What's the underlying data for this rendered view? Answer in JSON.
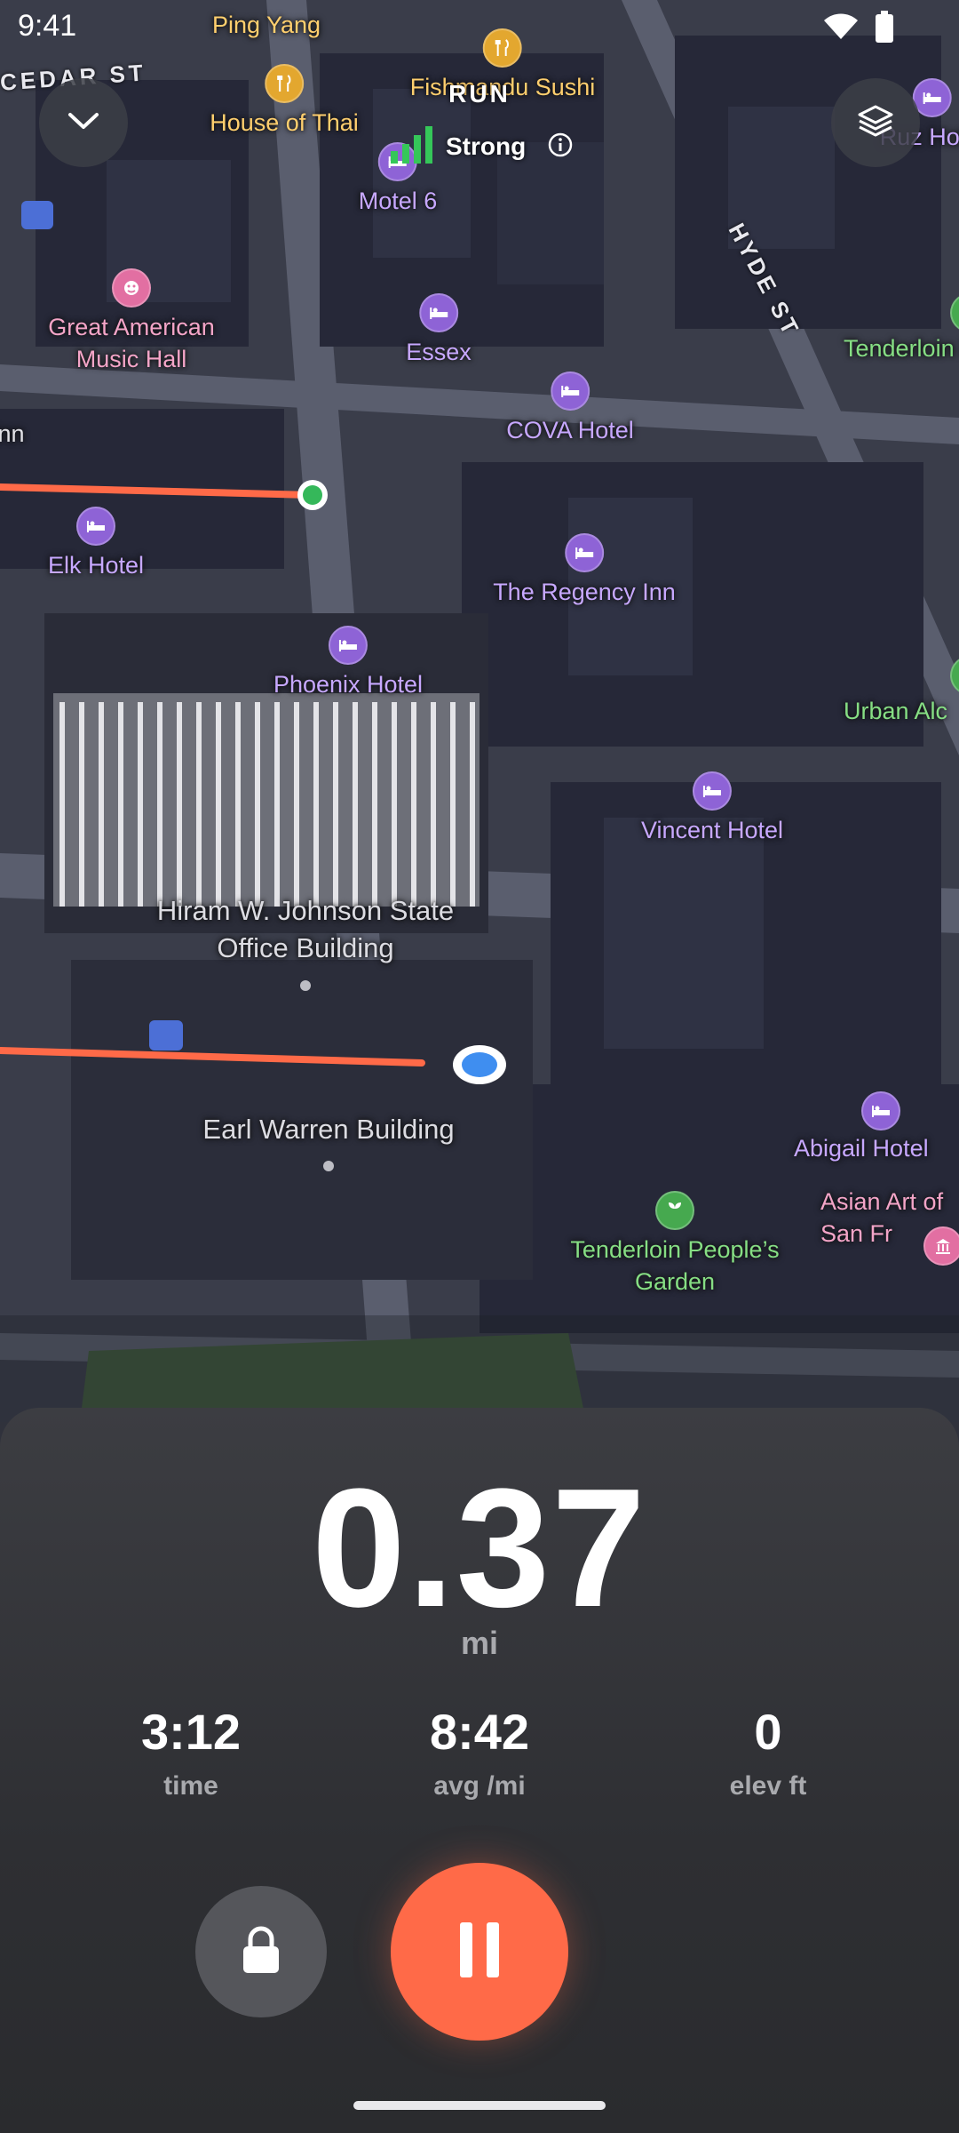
{
  "status_bar": {
    "time": "9:41"
  },
  "header": {
    "activity": "RUN",
    "gps_label": "Strong"
  },
  "map": {
    "streets": [
      "CEDAR ST",
      "HYDE ST"
    ],
    "pois": {
      "ping_yang": "Ping Yang",
      "fishmandu": "Fishmandu Sushi",
      "house_of_thai": "House of Thai",
      "motel6": "Motel 6",
      "hotel_ruz": "Ruz Hotel",
      "great_american": "Great American Music Hall",
      "essex": "Essex",
      "cova": "COVA Hotel",
      "tenderloin_play": "Tenderloin Playg",
      "inn_edge": "Inn",
      "elk": "Elk Hotel",
      "regency": "The Regency Inn",
      "phoenix": "Phoenix Hotel",
      "urban_alc": "Urban Alc",
      "vincent": "Vincent Hotel",
      "hiram": "Hiram W. Johnson State Office Building",
      "earl_warren": "Earl Warren Building",
      "abigail": "Abigail Hotel",
      "tenderloin_garden": "Tenderloin People’s Garden",
      "asian_art": "Asian Art of San Fr"
    }
  },
  "stats": {
    "distance_value": "0.37",
    "distance_unit": "mi",
    "time_value": "3:12",
    "time_label": "time",
    "pace_value": "8:42",
    "pace_label": "avg /mi",
    "elev_value": "0",
    "elev_label": "elev ft"
  },
  "colors": {
    "accent": "#ff6a48",
    "route": "#ff6a48",
    "gps_strong": "#35c759"
  }
}
